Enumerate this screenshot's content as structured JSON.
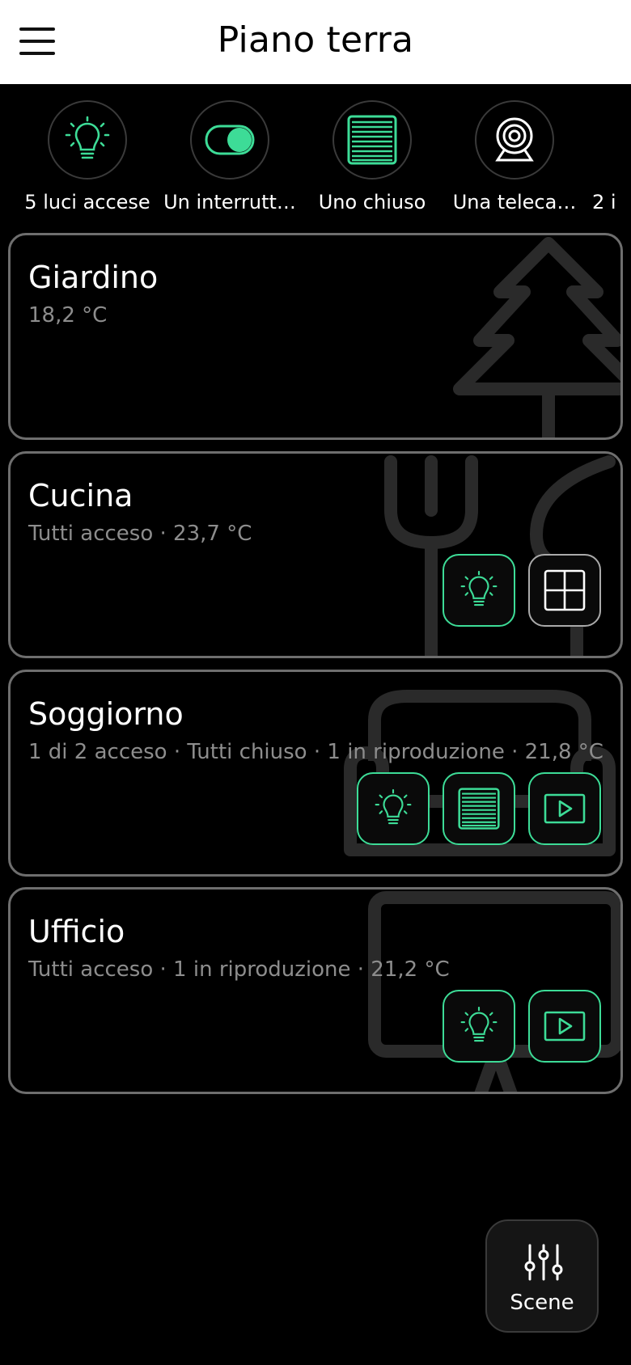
{
  "header": {
    "title": "Piano terra"
  },
  "summary": [
    {
      "label": "5 luci accese",
      "icon": "lightbulb-icon"
    },
    {
      "label": "Un interrutt…",
      "icon": "toggle-icon"
    },
    {
      "label": "Uno chiuso",
      "icon": "blinds-icon"
    },
    {
      "label": "Una teleca…",
      "icon": "webcam-icon"
    },
    {
      "label": "2 i",
      "icon": ""
    }
  ],
  "rooms": [
    {
      "name": "Giardino",
      "status": "18,2 °C",
      "bg_icon": "tree-icon",
      "actions": []
    },
    {
      "name": "Cucina",
      "status": "Tutti acceso · 23,7 °C",
      "bg_icon": "fork-knife-icon",
      "actions": [
        "lightbulb-icon",
        "window-icon"
      ]
    },
    {
      "name": "Soggiorno",
      "status": "1 di 2 acceso · Tutti chiuso · 1 in riproduzione · 21,8 °C",
      "bg_icon": "sofa-icon",
      "actions": [
        "lightbulb-icon",
        "blinds-icon",
        "media-player-icon"
      ]
    },
    {
      "name": "Ufficio",
      "status": "Tutti acceso · 1 in riproduzione · 21,2 °C",
      "bg_icon": "desk-icon",
      "actions": [
        "lightbulb-icon",
        "media-player-icon"
      ]
    }
  ],
  "scenes_button": {
    "label": "Scene",
    "icon": "sliders-icon"
  },
  "colors": {
    "accent": "#3ddc97",
    "card_border": "#6e6e6e",
    "muted_text": "#8d8d8d"
  }
}
